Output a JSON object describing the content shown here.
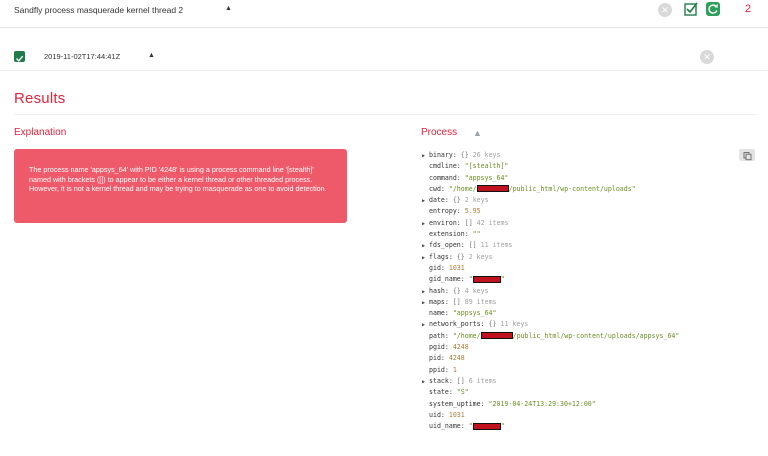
{
  "header": {
    "title": "Sandfly process masquerade kernel thread 2",
    "clear_icon": "x-circle-icon",
    "count": "2"
  },
  "result_row": {
    "timestamp": "2019-11-02T17:44:41Z"
  },
  "results_title": "Results",
  "explanation": {
    "title": "Explanation",
    "text": "The process name 'appsys_64' with PID '4248' is using a process command line '[stealth]' named with brackets ([]) to appear to be either a kernel thread or other threaded process. However, it is not a kernel thread and may be trying to masquerade as one to avoid detection."
  },
  "process": {
    "title": "Process",
    "rows": [
      {
        "expandable": true,
        "key": "binary:",
        "type": "{}",
        "meta": "26 keys"
      },
      {
        "indent": true,
        "key": "cmdline:",
        "value": "\"[stealth]\"",
        "vt": "str"
      },
      {
        "indent": true,
        "key": "command:",
        "value": "\"appsys_64\"",
        "vt": "str"
      },
      {
        "indent": true,
        "key": "cwd:",
        "value": "\"/home/",
        "vt": "str",
        "redact": true,
        "value_after": "/public_html/wp-content/uploads\""
      },
      {
        "expandable": true,
        "key": "date:",
        "type": "{}",
        "meta": "2 keys"
      },
      {
        "indent": true,
        "key": "entropy:",
        "value": "5.95",
        "vt": "num"
      },
      {
        "expandable": true,
        "key": "environ:",
        "type": "[]",
        "meta": "42 items"
      },
      {
        "indent": true,
        "key": "extension:",
        "value": "\"\"",
        "vt": "str"
      },
      {
        "expandable": true,
        "key": "fds_open:",
        "type": "[]",
        "meta": "11 items"
      },
      {
        "expandable": true,
        "key": "flags:",
        "type": "{}",
        "meta": "2 keys"
      },
      {
        "indent": true,
        "key": "gid:",
        "value": "1031",
        "vt": "num"
      },
      {
        "indent": true,
        "key": "gid_name:",
        "value": "\"",
        "vt": "str",
        "redact": true,
        "value_after": "\""
      },
      {
        "expandable": true,
        "key": "hash:",
        "type": "{}",
        "meta": "4 keys"
      },
      {
        "expandable": true,
        "key": "maps:",
        "type": "[]",
        "meta": "89 items"
      },
      {
        "indent": true,
        "key": "name:",
        "value": "\"appsys_64\"",
        "vt": "str"
      },
      {
        "expandable": true,
        "key": "network_ports:",
        "type": "{}",
        "meta": "11 keys"
      },
      {
        "indent": true,
        "key": "path:",
        "value": "\"/home/",
        "vt": "str",
        "redact": true,
        "value_after": "/public_html/wp-content/uploads/appsys_64\""
      },
      {
        "indent": true,
        "key": "pgid:",
        "value": "4248",
        "vt": "num"
      },
      {
        "indent": true,
        "key": "pid:",
        "value": "4248",
        "vt": "num"
      },
      {
        "indent": true,
        "key": "ppid:",
        "value": "1",
        "vt": "num"
      },
      {
        "expandable": true,
        "key": "stack:",
        "type": "[]",
        "meta": "6 items"
      },
      {
        "indent": true,
        "key": "state:",
        "value": "\"S\"",
        "vt": "str"
      },
      {
        "indent": true,
        "key": "system_uptime:",
        "value": "\"2019-04-24T13:29:30+12:00\"",
        "vt": "str"
      },
      {
        "indent": true,
        "key": "uid:",
        "value": "1031",
        "vt": "num"
      },
      {
        "indent": true,
        "key": "uid_name:",
        "value": "\"",
        "vt": "str",
        "redact": true,
        "value_after": "\""
      }
    ]
  },
  "colors": {
    "accent_red": "#e2243c",
    "box_red": "#ef5a6a",
    "green": "#207c4b",
    "string_green": "#6b8e23",
    "number_orange": "#ad7c3a"
  }
}
